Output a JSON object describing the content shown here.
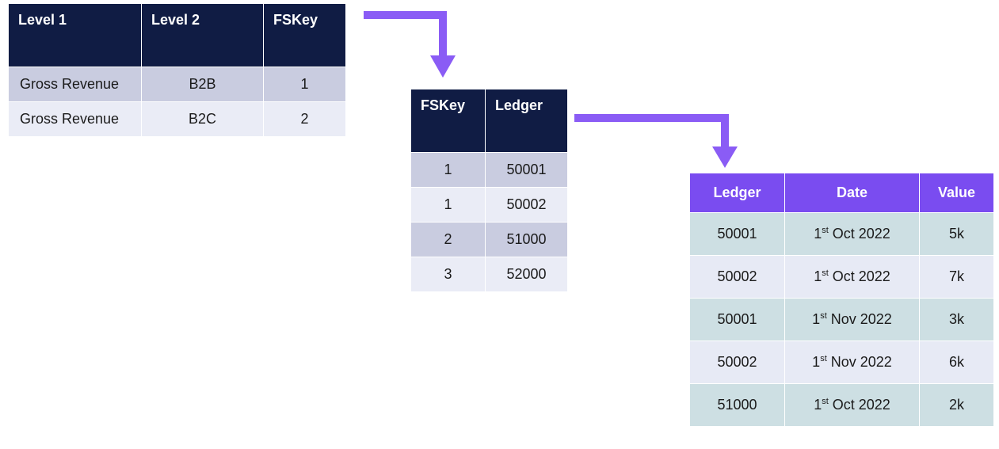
{
  "table1": {
    "headers": [
      "Level 1",
      "Level 2",
      "FSKey"
    ],
    "rows": [
      {
        "level1": "Gross Revenue",
        "level2": "B2B",
        "fskey": "1"
      },
      {
        "level1": "Gross Revenue",
        "level2": "B2C",
        "fskey": "2"
      }
    ]
  },
  "table2": {
    "headers": [
      "FSKey",
      "Ledger"
    ],
    "rows": [
      {
        "fskey": "1",
        "ledger": "50001"
      },
      {
        "fskey": "1",
        "ledger": "50002"
      },
      {
        "fskey": "2",
        "ledger": "51000"
      },
      {
        "fskey": "3",
        "ledger": "52000"
      }
    ]
  },
  "table3": {
    "headers": [
      "Ledger",
      "Date",
      "Value"
    ],
    "rows": [
      {
        "ledger": "50001",
        "day": "1",
        "suffix": "st",
        "rest": " Oct 2022",
        "value": "5k"
      },
      {
        "ledger": "50002",
        "day": "1",
        "suffix": "st",
        "rest": " Oct 2022",
        "value": "7k"
      },
      {
        "ledger": "50001",
        "day": "1",
        "suffix": "st",
        "rest": " Nov 2022",
        "value": "3k"
      },
      {
        "ledger": "50002",
        "day": "1",
        "suffix": "st",
        "rest": " Nov 2022",
        "value": "6k"
      },
      {
        "ledger": "51000",
        "day": "1",
        "suffix": "st",
        "rest": " Oct 2022",
        "value": "2k"
      }
    ]
  },
  "arrows": {
    "color": "#8a5cf5"
  }
}
